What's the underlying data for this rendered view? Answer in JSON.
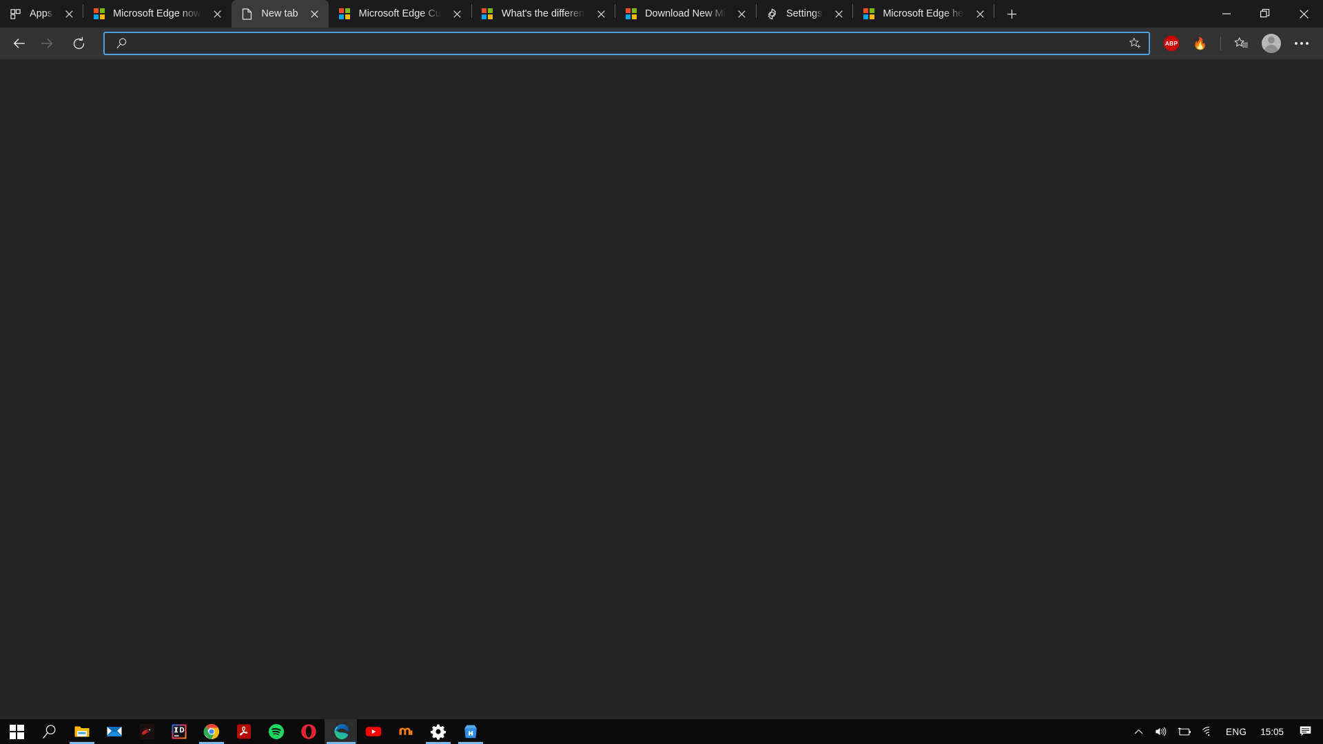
{
  "window": {
    "controls": {
      "minimize": "minimize-button",
      "restore": "restore-button",
      "close": "close-button"
    }
  },
  "tabstrip": {
    "new_tab_label": "New tab",
    "tabs": [
      {
        "title": "Apps",
        "icon": "apps-grid-icon",
        "active": false
      },
      {
        "title": "Microsoft Edge now",
        "icon": "microsoft-logo-icon",
        "active": false
      },
      {
        "title": "New tab",
        "icon": "page-icon",
        "active": true
      },
      {
        "title": "Microsoft Edge Cu",
        "icon": "microsoft-logo-icon",
        "active": false
      },
      {
        "title": "What's the differen",
        "icon": "microsoft-logo-icon",
        "active": false
      },
      {
        "title": "Download New Mi",
        "icon": "microsoft-logo-icon",
        "active": false
      },
      {
        "title": "Settings",
        "icon": "gear-icon",
        "active": false
      },
      {
        "title": "Microsoft Edge he",
        "icon": "microsoft-logo-icon",
        "active": false
      }
    ]
  },
  "toolbar": {
    "back_label": "Back",
    "forward_label": "Forward",
    "refresh_label": "Refresh",
    "address": {
      "value": "",
      "placeholder": ""
    },
    "add_favorite_label": "Add this page to favorites",
    "extensions": [
      {
        "name": "adblock-plus",
        "label": "ABP"
      },
      {
        "name": "extension-flame",
        "label": "🔥"
      }
    ],
    "favorites_label": "Favorites",
    "profile_label": "Profile",
    "settings_label": "Settings and more",
    "accent_color": "#4aa3e0"
  },
  "taskbar": {
    "apps": [
      {
        "name": "start-button",
        "running": false
      },
      {
        "name": "search-button",
        "running": false
      },
      {
        "name": "file-explorer",
        "running": true
      },
      {
        "name": "mail-app",
        "running": false
      },
      {
        "name": "kali-linux",
        "running": false
      },
      {
        "name": "intellij-idea",
        "running": false
      },
      {
        "name": "google-chrome",
        "running": true
      },
      {
        "name": "adobe-acrobat",
        "running": false
      },
      {
        "name": "spotify",
        "running": false
      },
      {
        "name": "opera-browser",
        "running": false
      },
      {
        "name": "microsoft-edge",
        "running": true,
        "active": true
      },
      {
        "name": "youtube",
        "running": false
      },
      {
        "name": "moodle",
        "running": false
      },
      {
        "name": "windows-settings",
        "running": true
      },
      {
        "name": "microsoft-store",
        "running": true
      }
    ],
    "tray": {
      "show_hidden_label": "",
      "volume_label": "",
      "battery_label": "",
      "network_label": "",
      "language": "ENG",
      "clock": "15:05",
      "action_center_label": ""
    }
  }
}
